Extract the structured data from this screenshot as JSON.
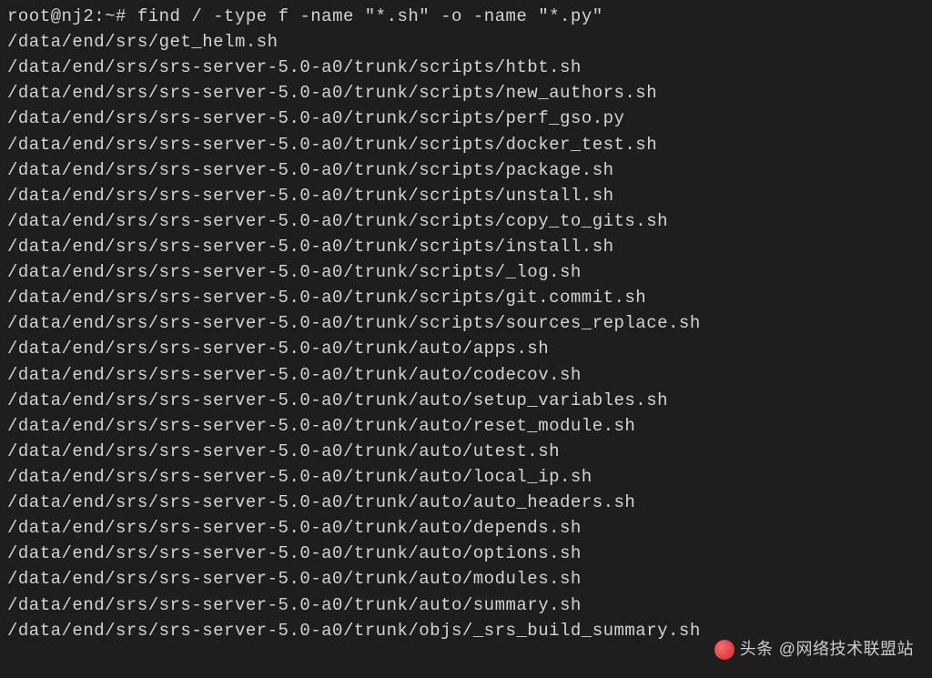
{
  "prompt": {
    "user_host": "root@nj2",
    "path": "~",
    "symbol": "#",
    "command": "find / -type f -name \"*.sh\" -o -name \"*.py\""
  },
  "output": [
    "/data/end/srs/get_helm.sh",
    "/data/end/srs/srs-server-5.0-a0/trunk/scripts/htbt.sh",
    "/data/end/srs/srs-server-5.0-a0/trunk/scripts/new_authors.sh",
    "/data/end/srs/srs-server-5.0-a0/trunk/scripts/perf_gso.py",
    "/data/end/srs/srs-server-5.0-a0/trunk/scripts/docker_test.sh",
    "/data/end/srs/srs-server-5.0-a0/trunk/scripts/package.sh",
    "/data/end/srs/srs-server-5.0-a0/trunk/scripts/unstall.sh",
    "/data/end/srs/srs-server-5.0-a0/trunk/scripts/copy_to_gits.sh",
    "/data/end/srs/srs-server-5.0-a0/trunk/scripts/install.sh",
    "/data/end/srs/srs-server-5.0-a0/trunk/scripts/_log.sh",
    "/data/end/srs/srs-server-5.0-a0/trunk/scripts/git.commit.sh",
    "/data/end/srs/srs-server-5.0-a0/trunk/scripts/sources_replace.sh",
    "/data/end/srs/srs-server-5.0-a0/trunk/auto/apps.sh",
    "/data/end/srs/srs-server-5.0-a0/trunk/auto/codecov.sh",
    "/data/end/srs/srs-server-5.0-a0/trunk/auto/setup_variables.sh",
    "/data/end/srs/srs-server-5.0-a0/trunk/auto/reset_module.sh",
    "/data/end/srs/srs-server-5.0-a0/trunk/auto/utest.sh",
    "/data/end/srs/srs-server-5.0-a0/trunk/auto/local_ip.sh",
    "/data/end/srs/srs-server-5.0-a0/trunk/auto/auto_headers.sh",
    "/data/end/srs/srs-server-5.0-a0/trunk/auto/depends.sh",
    "/data/end/srs/srs-server-5.0-a0/trunk/auto/options.sh",
    "/data/end/srs/srs-server-5.0-a0/trunk/auto/modules.sh",
    "/data/end/srs/srs-server-5.0-a0/trunk/auto/summary.sh",
    "/data/end/srs/srs-server-5.0-a0/trunk/objs/_srs_build_summary.sh"
  ],
  "watermark": {
    "prefix": "头条",
    "text": "@网络技术联盟站"
  }
}
